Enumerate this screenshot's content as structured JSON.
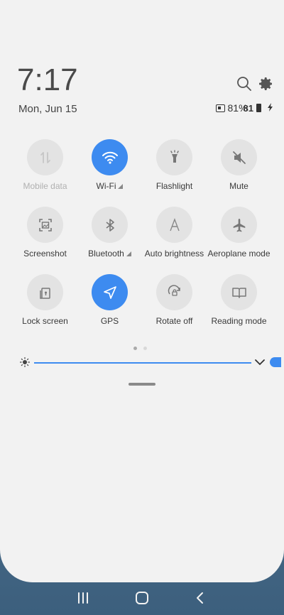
{
  "header": {
    "time": "7:17",
    "date": "Mon, Jun 15",
    "battery_percent": "81%",
    "battery_badge": "81"
  },
  "tiles": [
    {
      "label": "Mobile data",
      "state": "disabled",
      "icon": "mobile-data-icon"
    },
    {
      "label": "Wi-Fi",
      "state": "on",
      "icon": "wifi-icon",
      "has_menu": true
    },
    {
      "label": "Flashlight",
      "state": "off",
      "icon": "flashlight-icon"
    },
    {
      "label": "Mute",
      "state": "off",
      "icon": "mute-icon"
    },
    {
      "label": "Screenshot",
      "state": "off",
      "icon": "screenshot-icon"
    },
    {
      "label": "Bluetooth",
      "state": "off",
      "icon": "bluetooth-icon",
      "has_menu": true
    },
    {
      "label": "Auto brightness",
      "state": "off",
      "icon": "auto-brightness-icon"
    },
    {
      "label": "Aeroplane mode",
      "state": "off",
      "icon": "airplane-icon"
    },
    {
      "label": "Lock screen",
      "state": "off",
      "icon": "lock-screen-icon"
    },
    {
      "label": "GPS",
      "state": "on",
      "icon": "gps-icon"
    },
    {
      "label": "Rotate off",
      "state": "off",
      "icon": "rotate-icon"
    },
    {
      "label": "Reading mode",
      "state": "off",
      "icon": "reading-mode-icon"
    }
  ],
  "pager": {
    "pages": 2,
    "current": 1
  },
  "brightness": {
    "level": 1.0
  },
  "colors": {
    "accent": "#3d8bf0",
    "panel_bg": "#f2f2f2",
    "tile_off": "#e3e3e3"
  }
}
